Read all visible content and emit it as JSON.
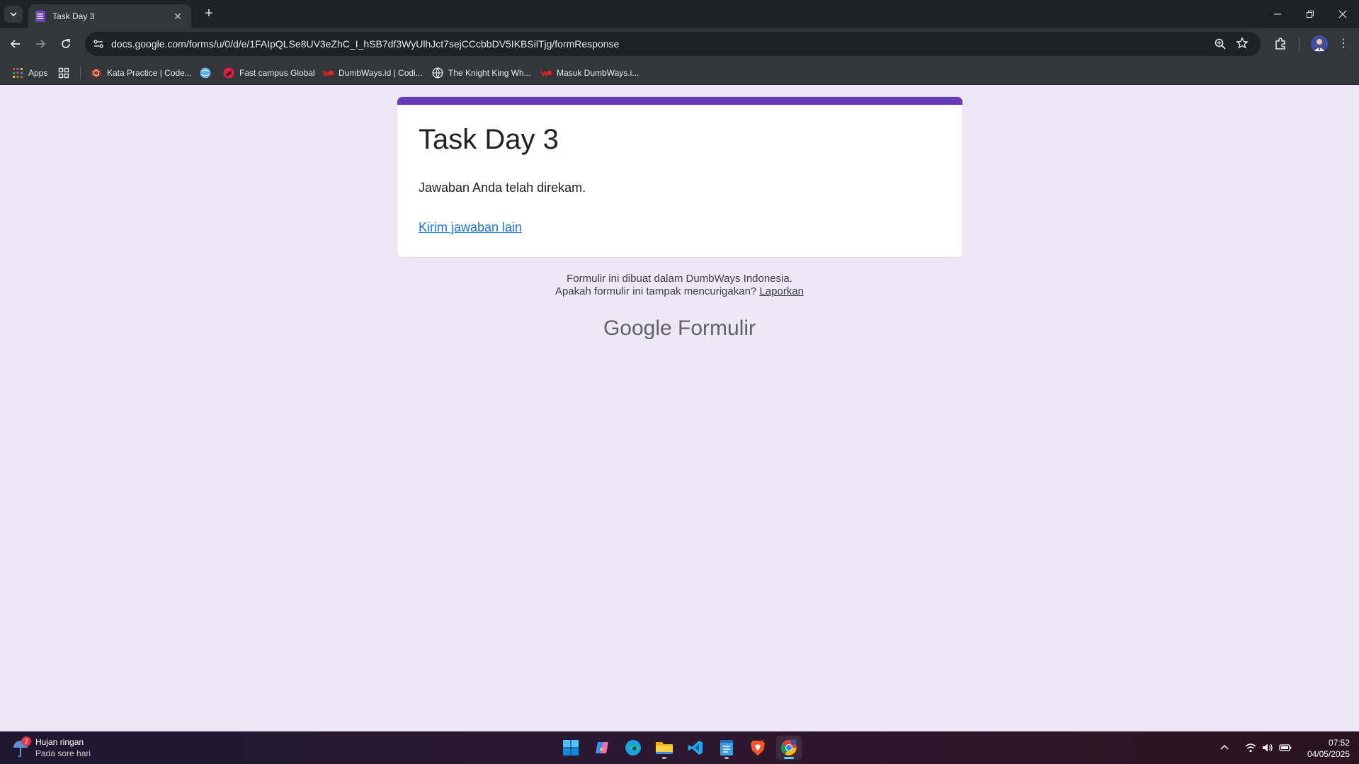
{
  "browser": {
    "tab_title": "Task Day 3",
    "url": "docs.google.com/forms/u/0/d/e/1FAIpQLSe8UV3eZhC_I_hSB7df3WyUlhJct7sejCCcbbDV5IKBSilTjg/formResponse",
    "bookmarks": [
      {
        "label": "Apps",
        "icon": "apps-grid-icon"
      },
      {
        "label": "",
        "icon": "tab-groups-icon"
      },
      {
        "label": "Kata Practice | Code...",
        "icon": "codewars-icon",
        "color": "#b1361e"
      },
      {
        "label": "",
        "icon": "globe-blue-icon",
        "color": "#5dade2"
      },
      {
        "label": "Fast campus Global",
        "icon": "fastcampus-icon",
        "color": "#e11d48"
      },
      {
        "label": "DumbWays.id | Codi...",
        "icon": "dumbways-icon",
        "color": "#e02424"
      },
      {
        "label": "The Knight King Wh...",
        "icon": "globe-icon",
        "color": "#9aa0a6"
      },
      {
        "label": "Masuk DumbWays.i...",
        "icon": "dumbways-icon",
        "color": "#e02424"
      }
    ]
  },
  "form": {
    "title": "Task Day 3",
    "confirmation": "Jawaban Anda telah direkam.",
    "another_response": "Kirim jawaban lain",
    "accent_color": "#673ab7"
  },
  "footer": {
    "line1": "Formulir ini dibuat dalam DumbWays Indonesia.",
    "line2": "Apakah formulir ini tampak mencurigakan?",
    "report": "Laporkan",
    "brand_google": "Google",
    "brand_product": "Formulir"
  },
  "taskbar": {
    "weather_title": "Hujan ringan",
    "weather_sub": "Pada sore hari",
    "weather_badge": "2",
    "time": "07:52",
    "date": "04/05/2025",
    "apps": [
      "windows-start-icon",
      "copilot-icon",
      "edge-icon",
      "file-explorer-icon",
      "vscode-icon",
      "notepad-icon",
      "brave-icon",
      "chrome-icon"
    ]
  }
}
